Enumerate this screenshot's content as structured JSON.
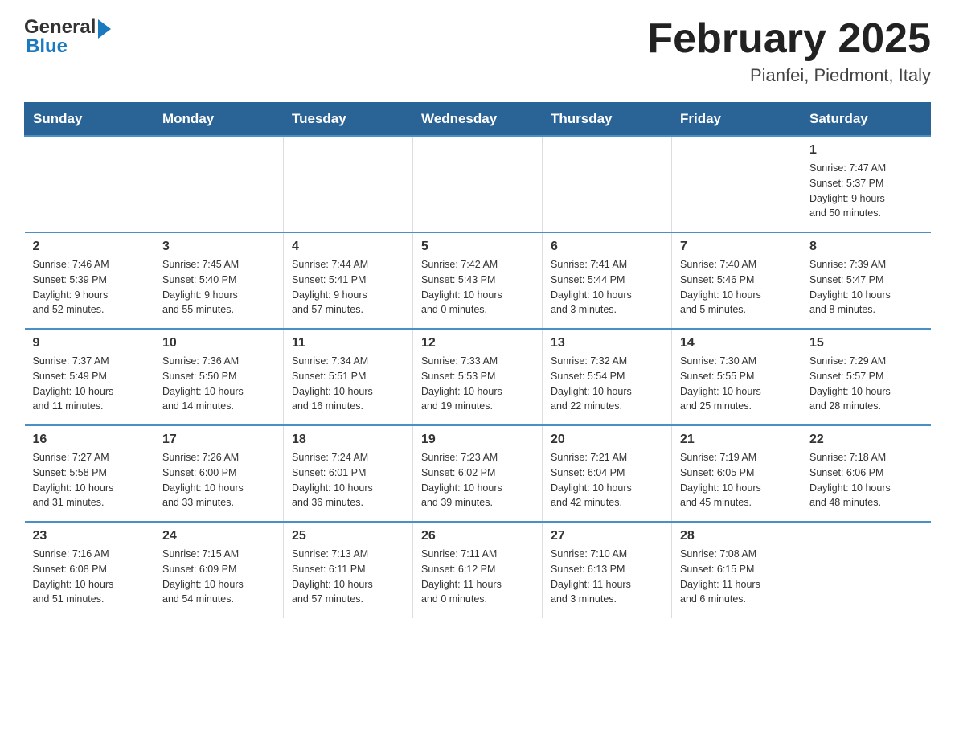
{
  "header": {
    "logo_general": "General",
    "logo_blue": "Blue",
    "month_title": "February 2025",
    "location": "Pianfei, Piedmont, Italy"
  },
  "calendar": {
    "days_of_week": [
      "Sunday",
      "Monday",
      "Tuesday",
      "Wednesday",
      "Thursday",
      "Friday",
      "Saturday"
    ],
    "weeks": [
      [
        {
          "day": "",
          "info": ""
        },
        {
          "day": "",
          "info": ""
        },
        {
          "day": "",
          "info": ""
        },
        {
          "day": "",
          "info": ""
        },
        {
          "day": "",
          "info": ""
        },
        {
          "day": "",
          "info": ""
        },
        {
          "day": "1",
          "info": "Sunrise: 7:47 AM\nSunset: 5:37 PM\nDaylight: 9 hours\nand 50 minutes."
        }
      ],
      [
        {
          "day": "2",
          "info": "Sunrise: 7:46 AM\nSunset: 5:39 PM\nDaylight: 9 hours\nand 52 minutes."
        },
        {
          "day": "3",
          "info": "Sunrise: 7:45 AM\nSunset: 5:40 PM\nDaylight: 9 hours\nand 55 minutes."
        },
        {
          "day": "4",
          "info": "Sunrise: 7:44 AM\nSunset: 5:41 PM\nDaylight: 9 hours\nand 57 minutes."
        },
        {
          "day": "5",
          "info": "Sunrise: 7:42 AM\nSunset: 5:43 PM\nDaylight: 10 hours\nand 0 minutes."
        },
        {
          "day": "6",
          "info": "Sunrise: 7:41 AM\nSunset: 5:44 PM\nDaylight: 10 hours\nand 3 minutes."
        },
        {
          "day": "7",
          "info": "Sunrise: 7:40 AM\nSunset: 5:46 PM\nDaylight: 10 hours\nand 5 minutes."
        },
        {
          "day": "8",
          "info": "Sunrise: 7:39 AM\nSunset: 5:47 PM\nDaylight: 10 hours\nand 8 minutes."
        }
      ],
      [
        {
          "day": "9",
          "info": "Sunrise: 7:37 AM\nSunset: 5:49 PM\nDaylight: 10 hours\nand 11 minutes."
        },
        {
          "day": "10",
          "info": "Sunrise: 7:36 AM\nSunset: 5:50 PM\nDaylight: 10 hours\nand 14 minutes."
        },
        {
          "day": "11",
          "info": "Sunrise: 7:34 AM\nSunset: 5:51 PM\nDaylight: 10 hours\nand 16 minutes."
        },
        {
          "day": "12",
          "info": "Sunrise: 7:33 AM\nSunset: 5:53 PM\nDaylight: 10 hours\nand 19 minutes."
        },
        {
          "day": "13",
          "info": "Sunrise: 7:32 AM\nSunset: 5:54 PM\nDaylight: 10 hours\nand 22 minutes."
        },
        {
          "day": "14",
          "info": "Sunrise: 7:30 AM\nSunset: 5:55 PM\nDaylight: 10 hours\nand 25 minutes."
        },
        {
          "day": "15",
          "info": "Sunrise: 7:29 AM\nSunset: 5:57 PM\nDaylight: 10 hours\nand 28 minutes."
        }
      ],
      [
        {
          "day": "16",
          "info": "Sunrise: 7:27 AM\nSunset: 5:58 PM\nDaylight: 10 hours\nand 31 minutes."
        },
        {
          "day": "17",
          "info": "Sunrise: 7:26 AM\nSunset: 6:00 PM\nDaylight: 10 hours\nand 33 minutes."
        },
        {
          "day": "18",
          "info": "Sunrise: 7:24 AM\nSunset: 6:01 PM\nDaylight: 10 hours\nand 36 minutes."
        },
        {
          "day": "19",
          "info": "Sunrise: 7:23 AM\nSunset: 6:02 PM\nDaylight: 10 hours\nand 39 minutes."
        },
        {
          "day": "20",
          "info": "Sunrise: 7:21 AM\nSunset: 6:04 PM\nDaylight: 10 hours\nand 42 minutes."
        },
        {
          "day": "21",
          "info": "Sunrise: 7:19 AM\nSunset: 6:05 PM\nDaylight: 10 hours\nand 45 minutes."
        },
        {
          "day": "22",
          "info": "Sunrise: 7:18 AM\nSunset: 6:06 PM\nDaylight: 10 hours\nand 48 minutes."
        }
      ],
      [
        {
          "day": "23",
          "info": "Sunrise: 7:16 AM\nSunset: 6:08 PM\nDaylight: 10 hours\nand 51 minutes."
        },
        {
          "day": "24",
          "info": "Sunrise: 7:15 AM\nSunset: 6:09 PM\nDaylight: 10 hours\nand 54 minutes."
        },
        {
          "day": "25",
          "info": "Sunrise: 7:13 AM\nSunset: 6:11 PM\nDaylight: 10 hours\nand 57 minutes."
        },
        {
          "day": "26",
          "info": "Sunrise: 7:11 AM\nSunset: 6:12 PM\nDaylight: 11 hours\nand 0 minutes."
        },
        {
          "day": "27",
          "info": "Sunrise: 7:10 AM\nSunset: 6:13 PM\nDaylight: 11 hours\nand 3 minutes."
        },
        {
          "day": "28",
          "info": "Sunrise: 7:08 AM\nSunset: 6:15 PM\nDaylight: 11 hours\nand 6 minutes."
        },
        {
          "day": "",
          "info": ""
        }
      ]
    ]
  }
}
